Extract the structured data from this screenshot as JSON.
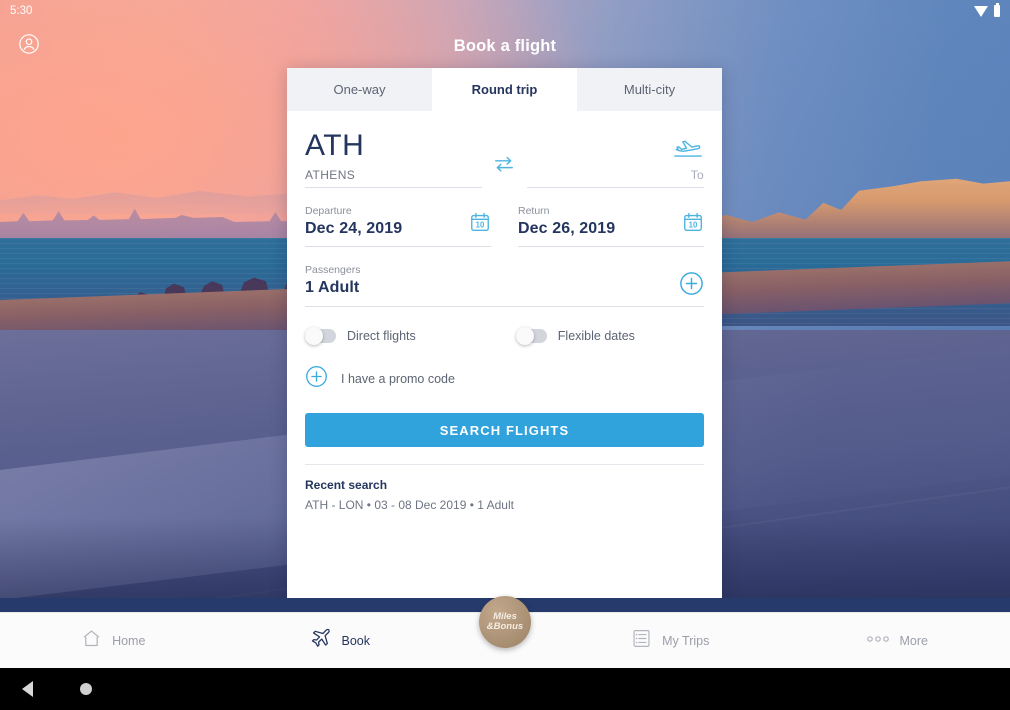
{
  "status_bar": {
    "time": "5:30",
    "wifi_icon": "wifi-icon",
    "battery_icon": "battery-icon"
  },
  "header": {
    "title": "Book a flight",
    "avatar_icon": "account-circle-icon"
  },
  "tabs": [
    {
      "label": "One-way",
      "active": false
    },
    {
      "label": "Round trip",
      "active": true
    },
    {
      "label": "Multi-city",
      "active": false
    }
  ],
  "route": {
    "origin_code": "ATH",
    "origin_city": "ATHENS",
    "swap_icon": "swap-horizontal-icon",
    "destination_icon": "plane-landing-icon",
    "destination_placeholder": "To"
  },
  "dates": {
    "departure_label": "Departure",
    "departure_value": "Dec 24, 2019",
    "departure_icon": "calendar-icon",
    "departure_icon_day": "10",
    "return_label": "Return",
    "return_value": "Dec 26, 2019",
    "return_icon": "calendar-icon",
    "return_icon_day": "10"
  },
  "passengers": {
    "label": "Passengers",
    "value": "1 Adult",
    "add_icon": "plus-circle-icon"
  },
  "options": {
    "direct_flights_label": "Direct flights",
    "direct_flights_on": false,
    "flexible_dates_label": "Flexible dates",
    "flexible_dates_on": false
  },
  "promo": {
    "label": "I have a promo code",
    "icon": "plus-circle-icon"
  },
  "search_button": {
    "label": "SEARCH FLIGHTS",
    "color": "#30a2dc"
  },
  "recent_search": {
    "title": "Recent search",
    "items": [
      "ATH - LON • 03 - 08 Dec 2019 • 1 Adult"
    ]
  },
  "bottom_nav": {
    "items": [
      {
        "label": "Home",
        "icon": "home-icon",
        "active": false
      },
      {
        "label": "Book",
        "icon": "airplane-icon",
        "active": true
      },
      {
        "label": "My Trips",
        "icon": "list-icon",
        "active": false
      },
      {
        "label": "More",
        "icon": "more-dots-icon",
        "active": false
      }
    ],
    "center_badge": {
      "line1": "Miles",
      "line2": "&Bonus",
      "icon": "miles-bonus-badge"
    }
  },
  "android_nav": {
    "back_icon": "back-triangle-icon",
    "home_icon": "home-circle-icon"
  },
  "colors": {
    "accent_blue": "#30a2dc",
    "dark_navy": "#24355e",
    "icon_blue": "#4db4e0",
    "badge_tan": "#a78e71"
  }
}
